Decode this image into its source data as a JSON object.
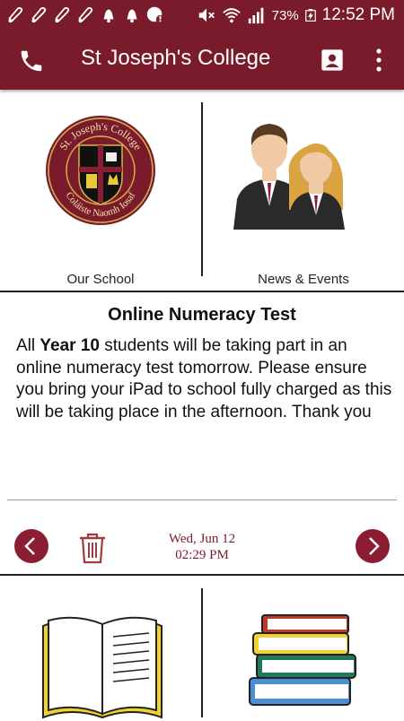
{
  "status_bar": {
    "battery_percent": "73%",
    "time": "12:52 PM",
    "icons": [
      "bell-icon",
      "bell-icon",
      "bell-icon",
      "bell-icon",
      "bell-icon",
      "bell-icon",
      "alert-icon",
      "mute-icon",
      "wifi-icon",
      "signal-icon",
      "battery-charging-icon"
    ]
  },
  "app_bar": {
    "title": "St Joseph's College",
    "icons": [
      "phone-icon",
      "contact-icon",
      "more-vert-icon"
    ]
  },
  "tiles": {
    "our_school": {
      "label": "Our School",
      "crest_top_text": "St. Joseph's College",
      "crest_bottom_text": "Coláiste Naomh Iosaf"
    },
    "news_events": {
      "label": "News & Events"
    }
  },
  "notice": {
    "title": "Online Numeracy Test",
    "body_prefix": "All ",
    "body_bold": "Year 10",
    "body_suffix": " students will be taking part in an online numeracy test tomorrow. Please ensure you bring your iPad to school fully charged as this will be taking place in the afternoon. Thank you",
    "date": "Wed, Jun 12",
    "time": "02:29 PM"
  },
  "colors": {
    "brand": "#7a1b2b",
    "nav_button": "#8b1d33"
  }
}
